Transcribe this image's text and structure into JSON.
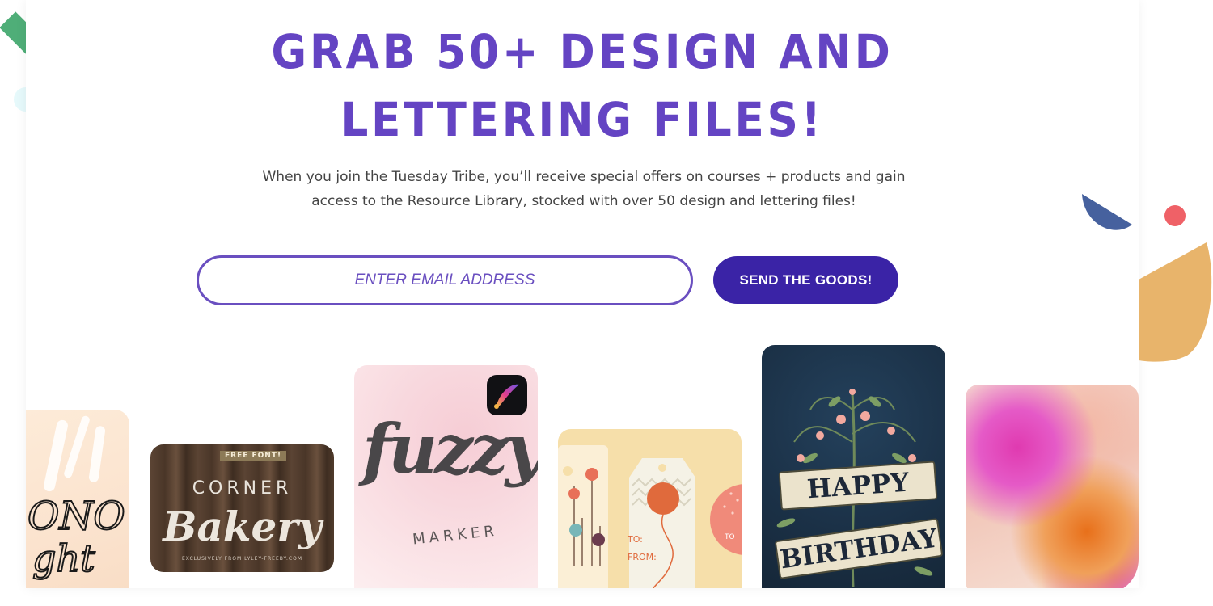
{
  "hero": {
    "title_line1": "GRAB 50+ DESIGN AND",
    "title_line2": "LETTERING FILES!",
    "description_line1": "When you join the Tuesday Tribe, you’ll receive special offers on courses + products and gain",
    "description_line2": "access to the Resource Library, stocked with over 50 design and lettering files!"
  },
  "signup": {
    "email_placeholder": "ENTER EMAIL ADDRESS",
    "email_value": "",
    "submit_label": "SEND THE GOODS!"
  },
  "previews": {
    "mono_text_1": "ONO",
    "mono_text_2": "ght",
    "bakery_badge": "FREE FONT!",
    "bakery_small": "CORNER",
    "bakery_script": "Bakery",
    "bakery_credit": "EXCLUSIVELY FROM LYLEY-FREEBY.COM",
    "fuzzy_script": "fuzzy",
    "fuzzy_sub": "MARKER",
    "tag_to": "TO:",
    "tag_from": "FROM:",
    "tag_right": "TO",
    "birthday_top": "HAPPY",
    "birthday_bottom": "BIRTHDAY"
  },
  "colors": {
    "brand_purple": "#6444c3",
    "button_navy": "#3a23a6",
    "accent_green": "#4fae78",
    "accent_gold": "#e8b46b",
    "accent_red": "#ef6167",
    "accent_blue": "#46619e"
  }
}
